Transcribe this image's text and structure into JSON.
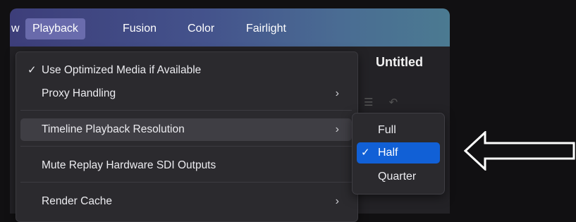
{
  "menubar": {
    "items": [
      {
        "label": "w",
        "active": false
      },
      {
        "label": "Playback",
        "active": true
      },
      {
        "label": "Fusion",
        "active": false
      },
      {
        "label": "Color",
        "active": false
      },
      {
        "label": "Fairlight",
        "active": false
      }
    ]
  },
  "app": {
    "title": "Untitled",
    "toolbar_icons": [
      "sort-icon",
      "undo-icon"
    ]
  },
  "playback_menu": {
    "items": [
      {
        "label": "Use Optimized Media if Available",
        "checked": true,
        "submenu": false
      },
      {
        "label": "Proxy Handling",
        "checked": false,
        "submenu": true
      },
      {
        "label": "Timeline Playback Resolution",
        "checked": false,
        "submenu": true,
        "highlighted": true
      },
      {
        "label": "Mute Replay Hardware SDI Outputs",
        "checked": false,
        "submenu": false
      },
      {
        "label": "Render Cache",
        "checked": false,
        "submenu": true
      }
    ]
  },
  "resolution_submenu": {
    "items": [
      {
        "label": "Full",
        "selected": false
      },
      {
        "label": "Half",
        "selected": true
      },
      {
        "label": "Quarter",
        "selected": false
      }
    ],
    "check_glyph": "✓"
  },
  "glyphs": {
    "chevron": "›",
    "check": "✓"
  },
  "colors": {
    "selection_blue": "#1160d6",
    "menubar_start": "#3d3e7a",
    "menubar_end": "#4b7a91"
  },
  "annotation": {
    "icon": "left-arrow-icon",
    "color": "#ffffff"
  }
}
